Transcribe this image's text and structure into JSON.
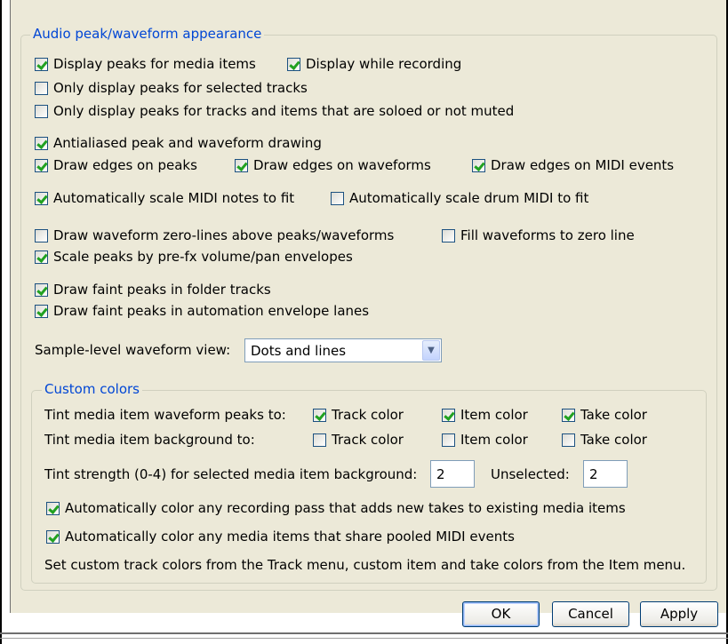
{
  "peaks_group": {
    "legend": "Audio peak/waveform appearance",
    "display_peaks": {
      "label": "Display peaks for media items",
      "checked": true
    },
    "display_while_recording": {
      "label": "Display while recording",
      "checked": true
    },
    "only_selected": {
      "label": "Only display peaks for selected tracks",
      "checked": false
    },
    "only_soloed": {
      "label": "Only display peaks for tracks and items that are soloed or not muted",
      "checked": false
    },
    "antialiased": {
      "label": "Antialiased peak and waveform drawing",
      "checked": true
    },
    "edges_peaks": {
      "label": "Draw edges on peaks",
      "checked": true
    },
    "edges_waveforms": {
      "label": "Draw edges on waveforms",
      "checked": true
    },
    "edges_midi": {
      "label": "Draw edges on MIDI events",
      "checked": true
    },
    "scale_midi": {
      "label": "Automatically scale MIDI notes to fit",
      "checked": true
    },
    "scale_drum": {
      "label": "Automatically scale drum MIDI to fit",
      "checked": false
    },
    "zero_lines": {
      "label": "Draw waveform zero-lines above peaks/waveforms",
      "checked": false
    },
    "fill_zero": {
      "label": "Fill waveforms to zero line",
      "checked": false
    },
    "scale_prefx": {
      "label": "Scale peaks by pre-fx volume/pan envelopes",
      "checked": true
    },
    "faint_folder": {
      "label": "Draw faint peaks in folder tracks",
      "checked": true
    },
    "faint_automation": {
      "label": "Draw faint peaks in automation envelope lanes",
      "checked": true
    },
    "sample_level_label": "Sample-level waveform view:",
    "sample_level_value": "Dots and lines"
  },
  "custom_colors": {
    "legend": "Custom colors",
    "tint_peaks_label": "Tint media item waveform peaks to:",
    "tint_peaks": [
      {
        "label": "Track color",
        "checked": true
      },
      {
        "label": "Item color",
        "checked": true
      },
      {
        "label": "Take color",
        "checked": true
      }
    ],
    "tint_bg_label": "Tint media item background to:",
    "tint_bg": [
      {
        "label": "Track color",
        "checked": false
      },
      {
        "label": "Item color",
        "checked": false
      },
      {
        "label": "Take color",
        "checked": false
      }
    ],
    "tint_strength_label": "Tint strength (0-4) for selected media item background:",
    "tint_strength_value": "2",
    "unselected_label": "Unselected:",
    "unselected_value": "2",
    "auto_color_recording": {
      "label": "Automatically color any recording pass that adds new takes to existing media items",
      "checked": true
    },
    "auto_color_pooled": {
      "label": "Automatically color any media items that share pooled MIDI events",
      "checked": true
    },
    "note": "Set custom track colors from the Track menu, custom item and take colors from the Item menu."
  },
  "buttons": {
    "ok": "OK",
    "cancel": "Cancel",
    "apply": "Apply"
  }
}
